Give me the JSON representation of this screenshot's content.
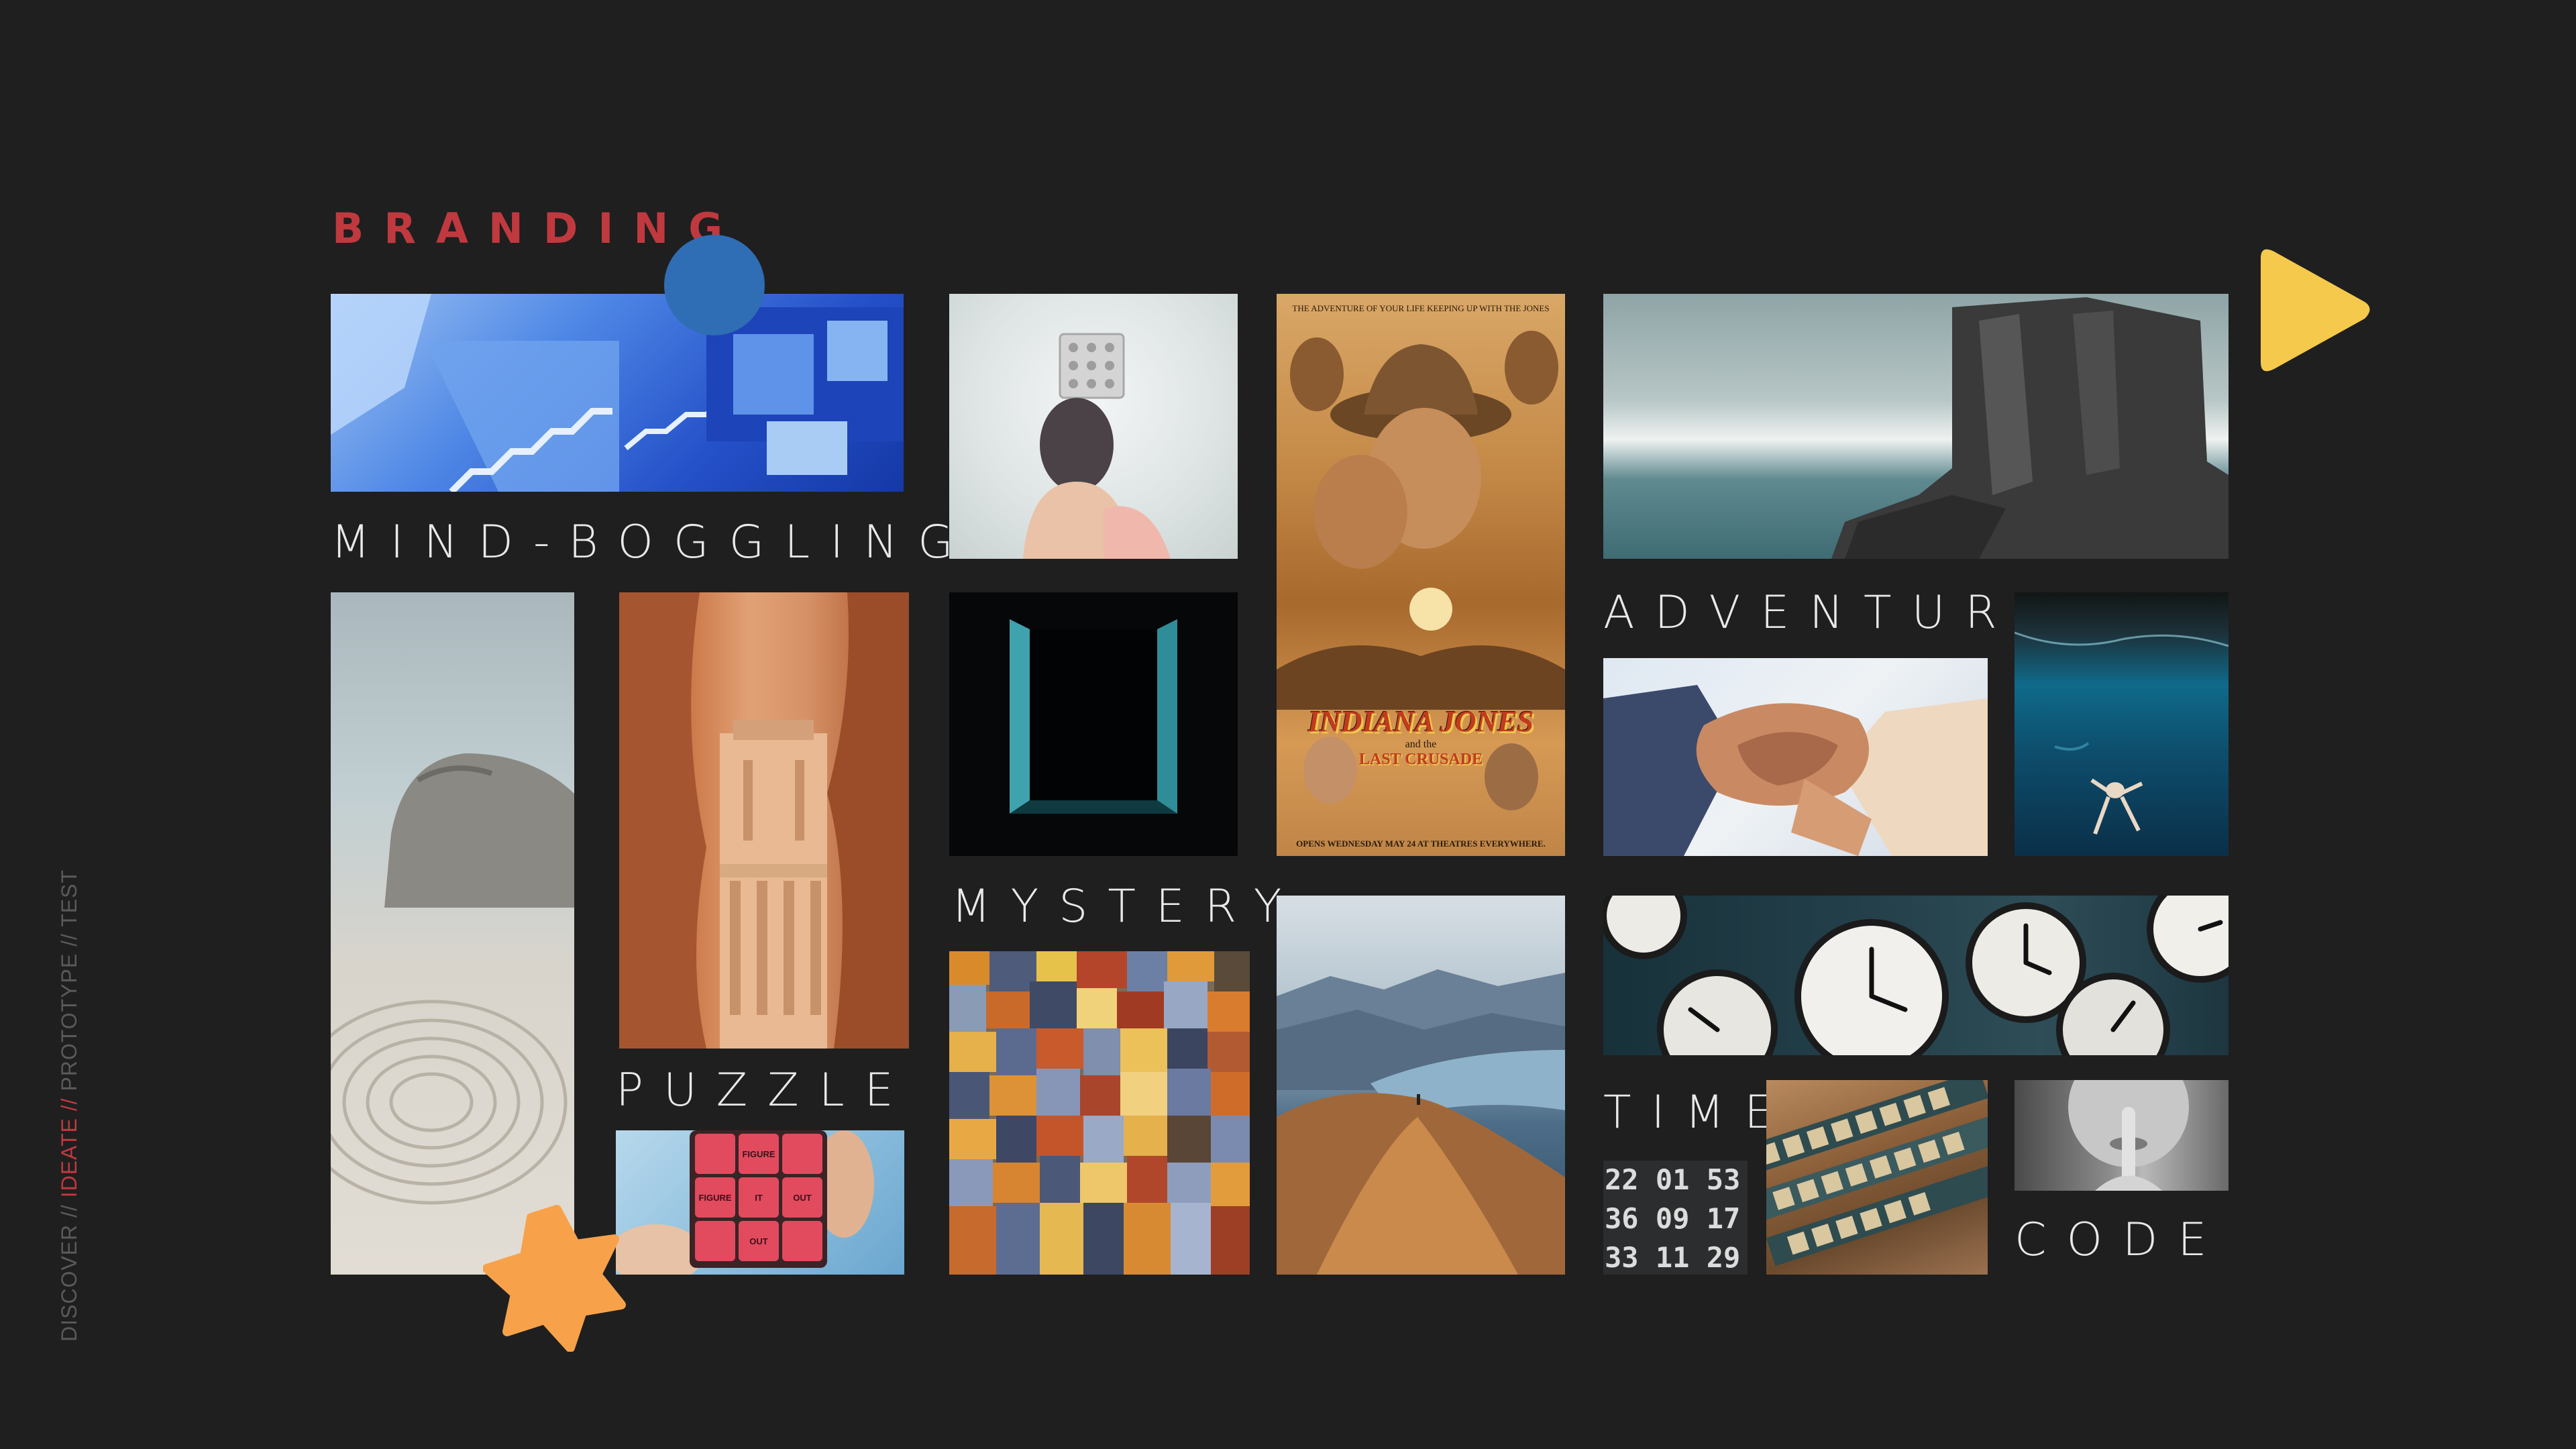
{
  "title": "BRANDING",
  "labels": {
    "mind_boggling": "MIND-BOGGLING",
    "mystery": "MYSTERY",
    "puzzle": "PUZZLE",
    "adventure": "ADVENTURE",
    "time": "TIME",
    "code": "CODE"
  },
  "side_nav": {
    "discover": "DISCOVER // ",
    "ideate": "IDEATE //",
    "rest": " PROTOTYPE // TEST"
  },
  "poster": {
    "tagline": "THE ADVENTURE OF YOUR LIFE KEEPING UP WITH THE JONES",
    "title_line1": "INDIANA JONES",
    "title_line2": "and the",
    "title_line3": "LAST CRUSADE",
    "release": "OPENS WEDNESDAY MAY 24 AT THEATRES EVERYWHERE."
  },
  "cube": {
    "figure_top": "FIGURE",
    "figure_left": "FIGURE",
    "it": "IT",
    "out_right": "OUT",
    "out_bottom": "OUT"
  },
  "flap": {
    "row1": "22 01 53",
    "row2": "36 09 17",
    "row3": "33 11 29"
  },
  "colors": {
    "background": "#1f1f1f",
    "accent_red": "#c0393f",
    "blue_circle": "#2f6db5",
    "yellow_triangle": "#f5c94c",
    "orange_star": "#f7a24a"
  }
}
